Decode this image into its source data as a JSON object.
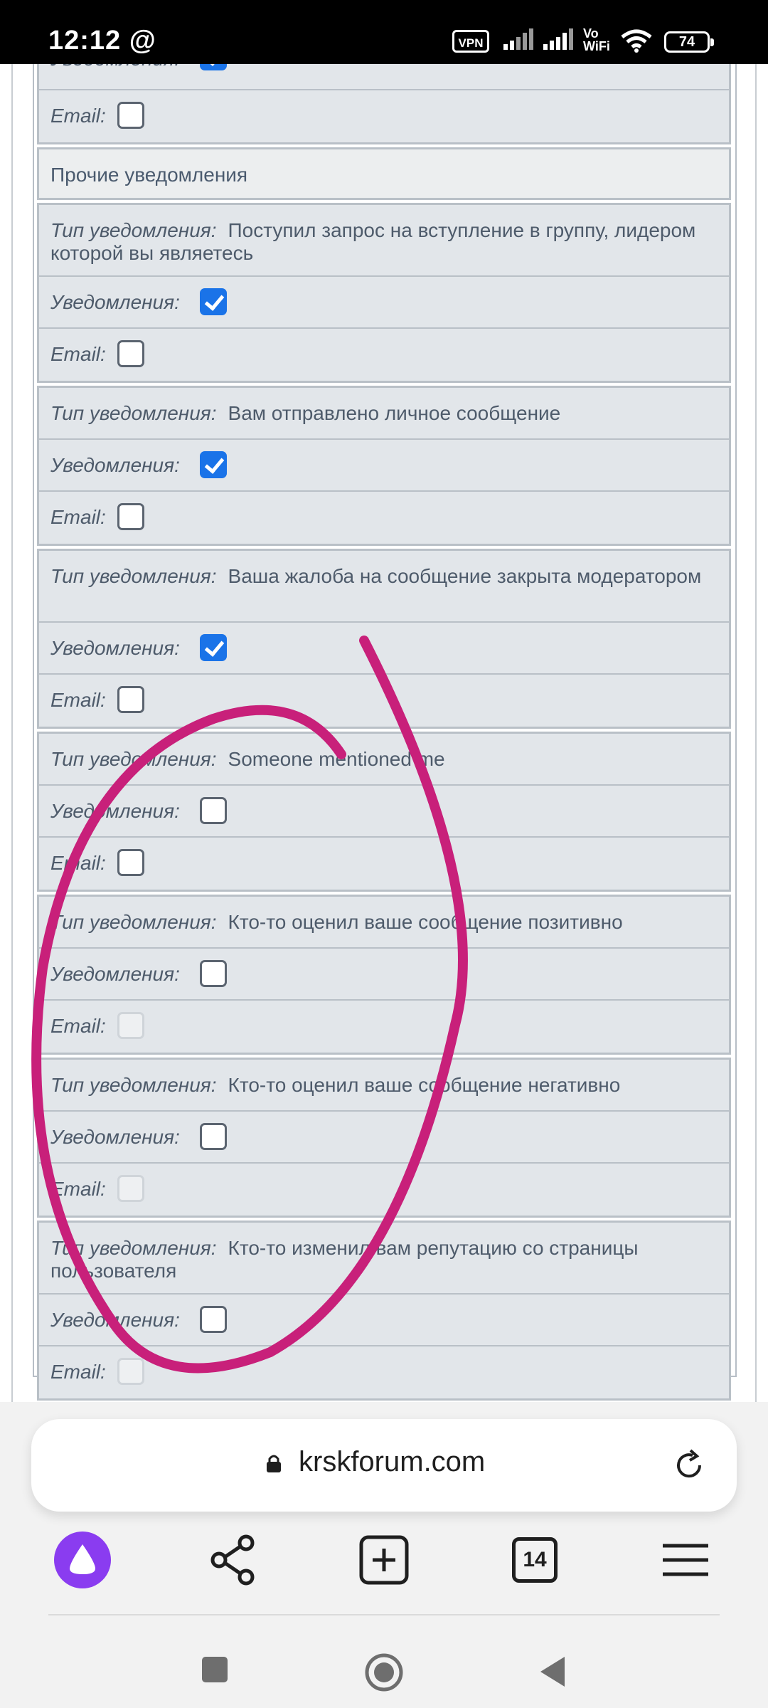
{
  "status_bar": {
    "time": "12:12",
    "at_icon": "@",
    "vpn": "VPN",
    "volte": "Vo\nWiFi",
    "battery": "74"
  },
  "form": {
    "top_row_label": "Уведомления:",
    "email_label": "Email:",
    "section_title": "Прочие уведомления",
    "type_label": "Тип уведомления:",
    "notif_label": "Уведомления:",
    "items": [
      {
        "type": "Поступил запрос на вступление в группу, лидером которой вы являетесь",
        "notifications": true,
        "email": false,
        "email_disabled": false
      },
      {
        "type": "Вам отправлено личное сообщение",
        "notifications": true,
        "email": false,
        "email_disabled": false
      },
      {
        "type": "Ваша жалоба на сообщение закрыта модератором",
        "notifications": true,
        "email": false,
        "email_disabled": false
      },
      {
        "type": "Someone mentioned me",
        "notifications": false,
        "email": false,
        "email_disabled": false
      },
      {
        "type": "Кто-то оценил ваше сообщение позитивно",
        "notifications": false,
        "email": false,
        "email_disabled": true
      },
      {
        "type": "Кто-то оценил ваше сообщение негативно",
        "notifications": false,
        "email": false,
        "email_disabled": true
      },
      {
        "type": "Кто-то изменил вам репутацию со страницы пользователя",
        "notifications": false,
        "email": false,
        "email_disabled": true
      }
    ]
  },
  "browser": {
    "url": "krskforum.com",
    "tabs_count": "14"
  },
  "colors": {
    "checkbox_checked": "#1a73e8",
    "annotation": "#c8207a",
    "alice_purple": "#8a3cf0"
  }
}
